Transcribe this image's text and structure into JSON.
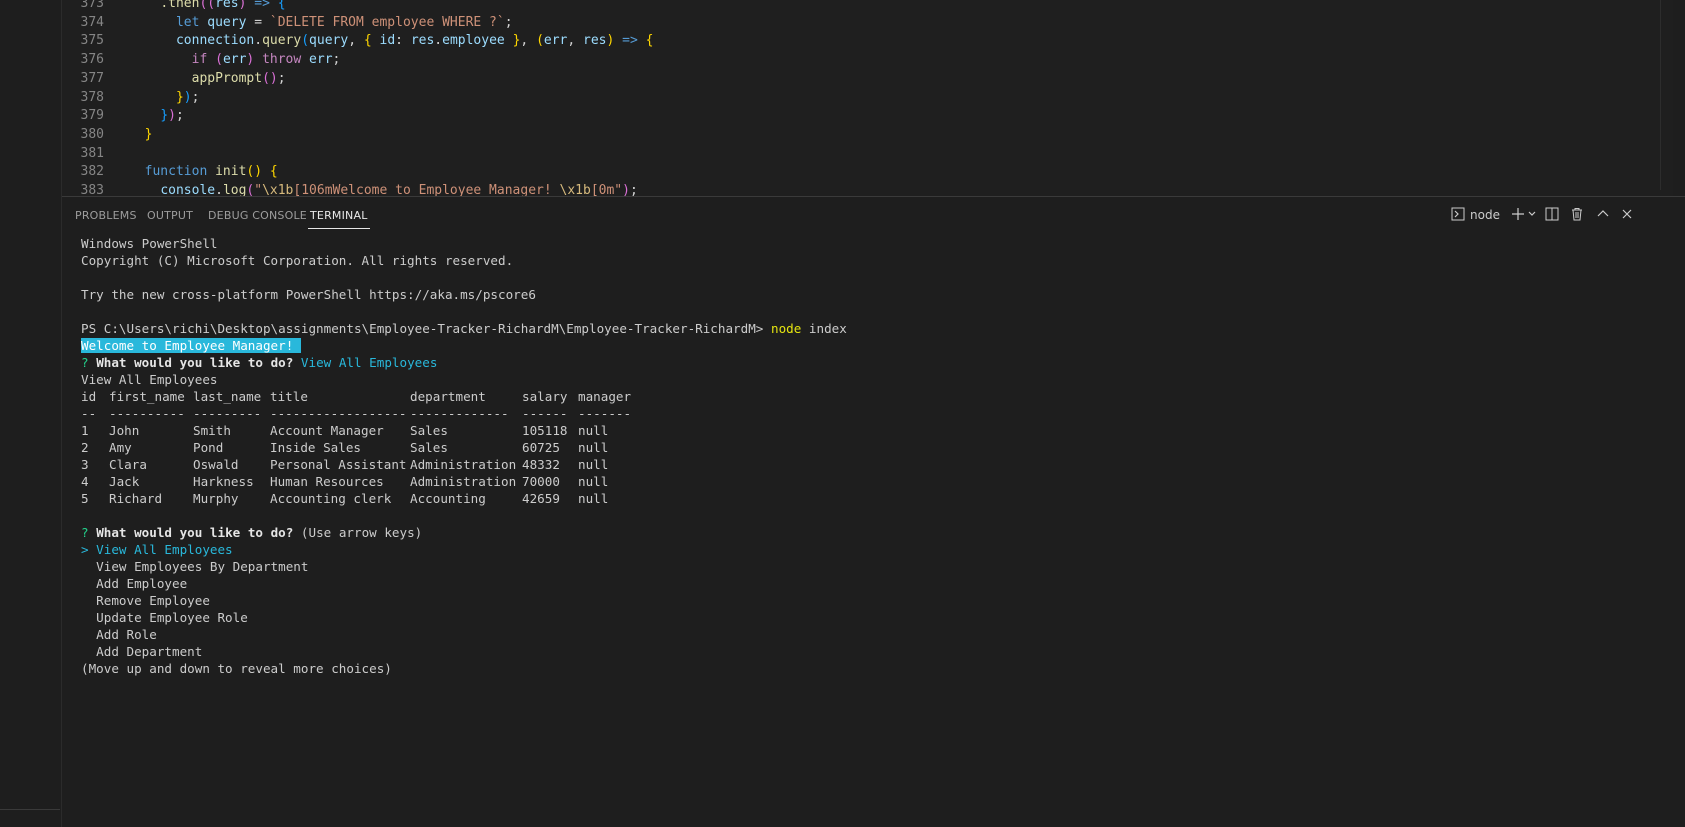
{
  "editor": {
    "lines": [
      {
        "n": "373",
        "html_parts": [
          [
            "",
            "    "
          ],
          [
            "fn",
            ".then"
          ],
          [
            "br2",
            "(("
          ],
          [
            "var",
            "res"
          ],
          [
            "br2",
            ")"
          ],
          [
            "",
            " "
          ],
          [
            "kw",
            "=>"
          ],
          [
            "",
            " "
          ],
          [
            "br3",
            "{"
          ]
        ]
      },
      {
        "n": "374",
        "html_parts": [
          [
            "",
            "      "
          ],
          [
            "kw",
            "let"
          ],
          [
            "",
            " "
          ],
          [
            "var",
            "query"
          ],
          [
            "",
            " = "
          ],
          [
            "str",
            "`DELETE FROM employee WHERE ?`"
          ],
          [
            "",
            ";"
          ]
        ]
      },
      {
        "n": "375",
        "html_parts": [
          [
            "",
            "      "
          ],
          [
            "var",
            "connection"
          ],
          [
            "",
            "."
          ],
          [
            "fn",
            "query"
          ],
          [
            "br3",
            "("
          ],
          [
            "var",
            "query"
          ],
          [
            "",
            ", "
          ],
          [
            "br1",
            "{"
          ],
          [
            "",
            " "
          ],
          [
            "var",
            "id"
          ],
          [
            "",
            ": "
          ],
          [
            "var",
            "res"
          ],
          [
            "",
            "."
          ],
          [
            "var",
            "employee"
          ],
          [
            "",
            " "
          ],
          [
            "br1",
            "}"
          ],
          [
            "",
            ", "
          ],
          [
            "br1",
            "("
          ],
          [
            "var",
            "err"
          ],
          [
            "",
            ", "
          ],
          [
            "var",
            "res"
          ],
          [
            "br1",
            ")"
          ],
          [
            "",
            " "
          ],
          [
            "kw",
            "=>"
          ],
          [
            "",
            " "
          ],
          [
            "br1",
            "{"
          ]
        ]
      },
      {
        "n": "376",
        "html_parts": [
          [
            "",
            "        "
          ],
          [
            "kw2",
            "if"
          ],
          [
            "",
            " "
          ],
          [
            "br2",
            "("
          ],
          [
            "var",
            "err"
          ],
          [
            "br2",
            ")"
          ],
          [
            "",
            " "
          ],
          [
            "kw2",
            "throw"
          ],
          [
            "",
            " "
          ],
          [
            "var",
            "err"
          ],
          [
            "",
            ";"
          ]
        ]
      },
      {
        "n": "377",
        "html_parts": [
          [
            "",
            "        "
          ],
          [
            "fn",
            "appPrompt"
          ],
          [
            "br2",
            "()"
          ],
          [
            "",
            ";"
          ]
        ]
      },
      {
        "n": "378",
        "html_parts": [
          [
            "",
            "      "
          ],
          [
            "br1",
            "}"
          ],
          [
            "br3",
            ")"
          ],
          [
            "",
            ";"
          ]
        ]
      },
      {
        "n": "379",
        "html_parts": [
          [
            "",
            "    "
          ],
          [
            "br3",
            "}"
          ],
          [
            "br2",
            ")"
          ],
          [
            "",
            ";"
          ]
        ]
      },
      {
        "n": "380",
        "html_parts": [
          [
            "",
            "  "
          ],
          [
            "br1",
            "}"
          ]
        ]
      },
      {
        "n": "381",
        "html_parts": [
          [
            "",
            ""
          ]
        ]
      },
      {
        "n": "382",
        "html_parts": [
          [
            "",
            "  "
          ],
          [
            "kw",
            "function"
          ],
          [
            "",
            " "
          ],
          [
            "fn",
            "init"
          ],
          [
            "br1",
            "()"
          ],
          [
            "",
            " "
          ],
          [
            "br1",
            "{"
          ]
        ]
      },
      {
        "n": "383",
        "html_parts": [
          [
            "",
            "    "
          ],
          [
            "var",
            "console"
          ],
          [
            "",
            "."
          ],
          [
            "fn",
            "log"
          ],
          [
            "br2",
            "("
          ],
          [
            "str",
            "\""
          ],
          [
            "esc",
            "\\x1b"
          ],
          [
            "str",
            "[106mWelcome to Employee Manager! "
          ],
          [
            "esc",
            "\\x1b"
          ],
          [
            "str",
            "[0m\""
          ],
          [
            "br2",
            ")"
          ],
          [
            "",
            ";"
          ]
        ]
      }
    ]
  },
  "panel": {
    "tabs": [
      "PROBLEMS",
      "OUTPUT",
      "DEBUG CONSOLE",
      "TERMINAL"
    ],
    "active_tab": "TERMINAL",
    "terminal_name": "node"
  },
  "terminal": {
    "line1": "Windows PowerShell",
    "line2": "Copyright (C) Microsoft Corporation. All rights reserved.",
    "line3": "Try the new cross-platform PowerShell https://aka.ms/pscore6",
    "prompt_path": "PS C:\\Users\\richi\\Desktop\\assignments\\Employee-Tracker-RichardM\\Employee-Tracker-RichardM>",
    "command": "node",
    "command_arg": "index",
    "welcome": "Welcome to Employee Manager! ",
    "question_mark": "?",
    "question": "What would you like to do?",
    "answer": "View All Employees",
    "echo": "View All Employees",
    "table": {
      "headers": [
        "id",
        "first_name",
        "last_name",
        "title",
        "department",
        "salary",
        "manager"
      ],
      "separators": [
        "--",
        "----------",
        "---------",
        "------------------",
        "-------------",
        "------",
        "-------"
      ],
      "rows": [
        [
          "1",
          "John",
          "Smith",
          "Account Manager",
          "Sales",
          "105118",
          "null"
        ],
        [
          "2",
          "Amy",
          "Pond",
          "Inside Sales",
          "Sales",
          "60725",
          "null"
        ],
        [
          "3",
          "Clara",
          "Oswald",
          "Personal Assistant",
          "Administration",
          "48332",
          "null"
        ],
        [
          "4",
          "Jack",
          "Harkness",
          "Human Resources",
          "Administration",
          "70000",
          "null"
        ],
        [
          "5",
          "Richard",
          "Murphy",
          "Accounting clerk",
          "Accounting",
          "42659",
          "null"
        ]
      ]
    },
    "hint": "(Use arrow keys)",
    "pointer": ">",
    "choices": [
      "View All Employees",
      "View Employees By Department",
      "Add Employee",
      "Remove Employee",
      "Update Employee Role",
      "Add Role",
      "Add Department"
    ],
    "footer": "(Move up and down to reveal more choices)"
  },
  "colors": {
    "background": "#1e1e1e",
    "terminal_text": "#cccccc",
    "cyan": "#29b8db",
    "yellow": "#e5e510"
  },
  "icons": [
    "terminal-icon",
    "plus-icon",
    "chevron-down-icon",
    "split-icon",
    "trash-icon",
    "maximize-icon",
    "close-icon"
  ]
}
